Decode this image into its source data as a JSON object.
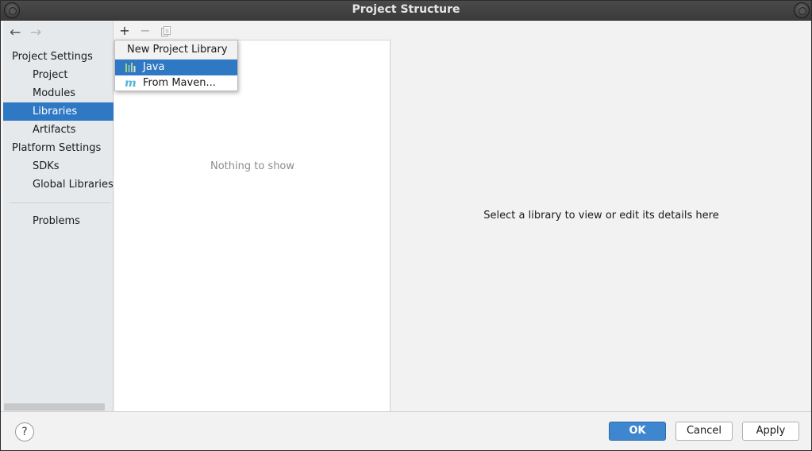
{
  "window": {
    "title": "Project Structure"
  },
  "nav": {
    "back_icon": "←",
    "forward_icon": "→",
    "project_settings": "Project Settings",
    "project": "Project",
    "modules": "Modules",
    "libraries": "Libraries",
    "artifacts": "Artifacts",
    "platform_settings": "Platform Settings",
    "sdks": "SDKs",
    "global_libraries": "Global Libraries",
    "problems": "Problems",
    "selected": "Libraries"
  },
  "toolbar": {
    "add_icon": "+",
    "remove_icon": "−",
    "copy_icon": "copy-icon"
  },
  "popup": {
    "title": "New Project Library",
    "items": [
      {
        "label": "Java",
        "icon": "java-library-icon",
        "selected": true
      },
      {
        "label": "From Maven...",
        "icon": "maven-icon",
        "selected": false
      }
    ]
  },
  "list": {
    "empty_text": "Nothing to show"
  },
  "details": {
    "placeholder": "Select a library to view or edit its details here"
  },
  "footer": {
    "help_icon": "?",
    "ok": "OK",
    "cancel": "Cancel",
    "apply": "Apply"
  },
  "colors": {
    "selection": "#2f78c4",
    "primary_button": "#3f86d0",
    "maven_icon": "#4fb3d9"
  }
}
